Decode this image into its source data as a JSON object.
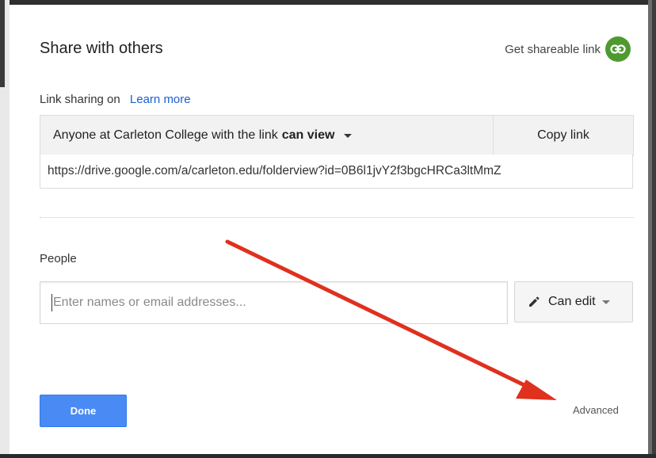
{
  "dialog": {
    "title": "Share with others",
    "shareable_link_label": "Get shareable link",
    "link_sharing": {
      "status": "Link sharing on",
      "learn_more": "Learn more",
      "access_prefix": "Anyone at Carleton College with the link",
      "access_level": "can view",
      "copy_label": "Copy link",
      "url": "https://drive.google.com/a/carleton.edu/folderview?id=0B6l1jvY2f3bgcHRCa3ltMmZ"
    },
    "people": {
      "label": "People",
      "placeholder": "Enter names or email addresses...",
      "permission": "Can edit"
    },
    "done_label": "Done",
    "advanced_label": "Advanced"
  },
  "colors": {
    "accent_blue": "#4a8af4",
    "link_blue": "#1a5fd1",
    "share_green": "#4e9a2f",
    "annotation_red": "#e0301e"
  },
  "icons": [
    "link-icon",
    "pencil-icon",
    "chevron-down-icon"
  ]
}
